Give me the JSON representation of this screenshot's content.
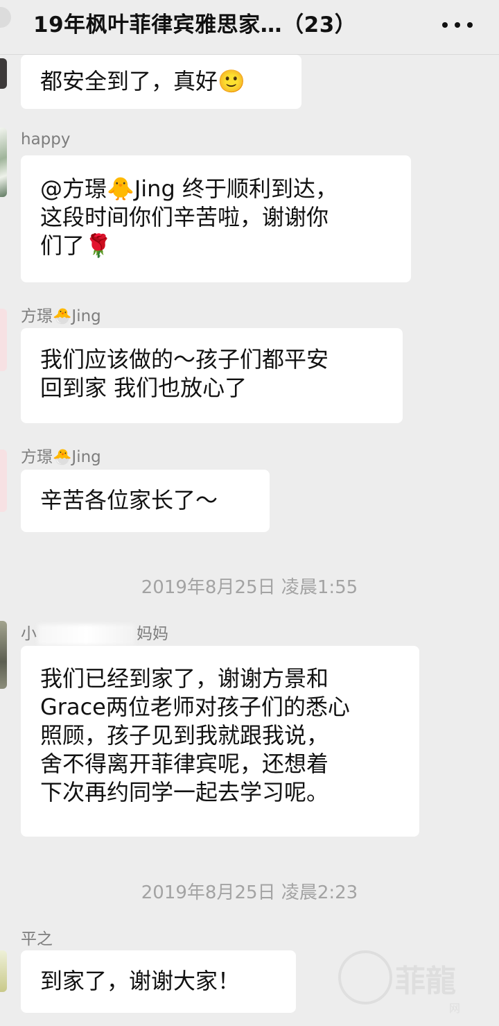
{
  "header": {
    "title": "19年枫叶菲律宾雅思家…（23）",
    "more_icon": "more-dots-icon"
  },
  "messages": [
    {
      "sender": "",
      "lines": [
        "都安全到了，真好🙂"
      ]
    },
    {
      "sender": "happy",
      "lines": [
        "@方璟🐥Jing 终于顺利到达，",
        "这段时间你们辛苦啦，谢谢你",
        "们了🌹"
      ]
    },
    {
      "sender_prefix": "方璟",
      "sender_emoji": "🐣",
      "sender_suffix": "Jing",
      "lines": [
        "我们应该做的～孩子们都平安",
        "回到家 我们也放心了"
      ]
    },
    {
      "sender_prefix": "方璟",
      "sender_emoji": "🐣",
      "sender_suffix": "Jing",
      "lines": [
        "辛苦各位家长了～"
      ]
    },
    {
      "sender_prefix": "小",
      "sender_suffix": "妈妈",
      "lines": [
        "我们已经到家了，谢谢方景和",
        "Grace两位老师对孩子们的悉心",
        "照顾，孩子见到我就跟我说，",
        "舍不得离开菲律宾呢，还想着",
        "下次再约同学一起去学习呢。"
      ]
    },
    {
      "sender": "平之",
      "lines": [
        "到家了，谢谢大家！"
      ]
    }
  ],
  "timestamps": [
    "2019年8月25日 凌晨1:55",
    "2019年8月25日 凌晨2:23"
  ],
  "colors": {
    "background": "#ededed",
    "bubble": "#ffffff",
    "sender": "#7d7d7d",
    "timestamp": "#a3a3a3"
  }
}
